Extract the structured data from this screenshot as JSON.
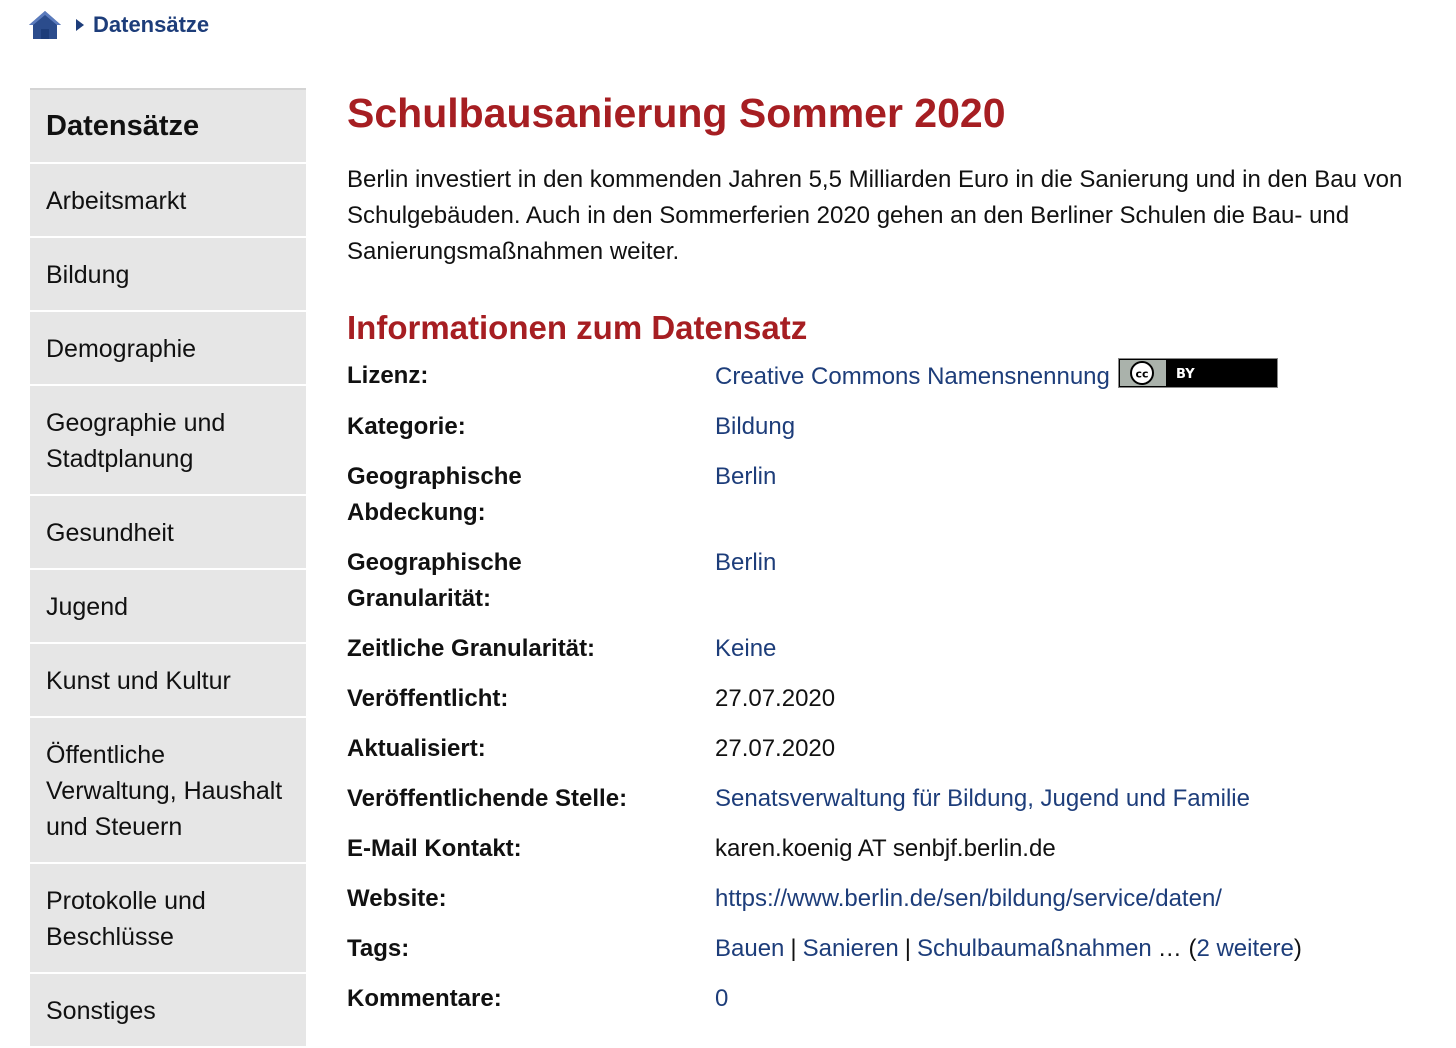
{
  "breadcrumb": {
    "current": "Datensätze"
  },
  "sidebar": {
    "heading": "Datensätze",
    "items": [
      "Arbeitsmarkt",
      "Bildung",
      "Demographie",
      "Geographie und Stadtplanung",
      "Gesundheit",
      "Jugend",
      "Kunst und Kultur",
      "Öffentliche Verwaltung, Haushalt und Steuern",
      "Protokolle und Beschlüsse",
      "Sonstiges"
    ]
  },
  "dataset": {
    "title": "Schulbausanierung Sommer 2020",
    "description": "Berlin investiert in den kommenden Jahren 5,5 Milliarden Euro in die Sanierung und in den Bau von Schulgebäuden. Auch in den Sommerferien 2020 gehen an den Berliner Schulen die Bau- und Sanierungsmaßnahmen weiter.",
    "info_heading": "Informationen zum Datensatz",
    "license": {
      "label": "Lizenz:",
      "value": "Creative Commons Namensnennung",
      "badge_text": "BY"
    },
    "category": {
      "label": "Kategorie:",
      "value": "Bildung"
    },
    "geo_coverage": {
      "label": "Geographische Abdeckung:",
      "value": "Berlin"
    },
    "geo_granularity": {
      "label": "Geographische Granularität:",
      "value": "Berlin"
    },
    "time_granularity": {
      "label": "Zeitliche Granularität:",
      "value": "Keine"
    },
    "published": {
      "label": "Veröffentlicht:",
      "value": "27.07.2020"
    },
    "updated": {
      "label": "Aktualisiert:",
      "value": "27.07.2020"
    },
    "publisher": {
      "label": "Veröffentlichende Stelle:",
      "value": "Senatsverwaltung für Bildung, Jugend und Familie"
    },
    "email": {
      "label": "E-Mail Kontakt:",
      "value": "karen.koenig AT senbjf.berlin.de"
    },
    "website": {
      "label": "Website:",
      "value": "https://www.berlin.de/sen/bildung/service/daten/"
    },
    "tags": {
      "label": "Tags:",
      "items": [
        "Bauen",
        "Sanieren",
        "Schulbaumaßnahmen"
      ],
      "separator": "|",
      "ellipsis": "…",
      "more_open": "(",
      "more": "2 weitere",
      "more_close": ")"
    },
    "comments": {
      "label": "Kommentare:",
      "value": "0"
    }
  },
  "colors": {
    "link": "#1d3d7a",
    "heading": "#a61e22",
    "sidebar_bg": "#e6e6e6"
  }
}
